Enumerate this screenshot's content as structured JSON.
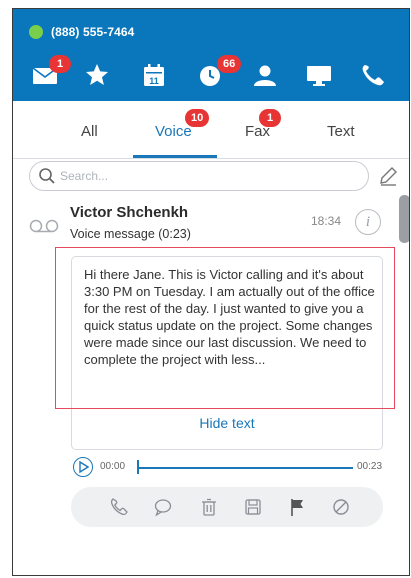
{
  "status": {
    "phone_number": "(888) 555-7464",
    "online_color": "#79cf4b"
  },
  "topbar": {
    "bg_color": "#0a77bd",
    "icons": [
      {
        "name": "mail-icon",
        "badge": "1"
      },
      {
        "name": "star-icon",
        "badge": ""
      },
      {
        "name": "calendar-icon",
        "badge": ""
      },
      {
        "name": "history-icon",
        "badge": "66"
      },
      {
        "name": "contacts-icon",
        "badge": ""
      },
      {
        "name": "desktop-icon",
        "badge": ""
      },
      {
        "name": "phone-icon",
        "badge": ""
      }
    ]
  },
  "tabs": [
    {
      "label": "All",
      "badge": ""
    },
    {
      "label": "Voice",
      "badge": "10",
      "active": true
    },
    {
      "label": "Fax",
      "badge": "1"
    },
    {
      "label": "Text",
      "badge": ""
    }
  ],
  "search": {
    "placeholder": "Search..."
  },
  "message": {
    "caller": "Victor Shchenkh",
    "subtitle": "Voice message (0:23)",
    "time": "18:34",
    "info_label": "i",
    "transcript": "Hi there Jane. This is Victor calling and it's about 3:30 PM on Tuesday. I am actually out of the office for the rest of the day. I just wanted to give you a quick status update on the project. Some changes were made since our last discussion. We need to complete the project with less...",
    "hide_label": "Hide text"
  },
  "player": {
    "current": "00:00",
    "duration": "00:23",
    "progress": 0
  },
  "actions": [
    {
      "name": "call-back-icon"
    },
    {
      "name": "message-icon"
    },
    {
      "name": "trash-icon"
    },
    {
      "name": "save-icon"
    },
    {
      "name": "flag-icon"
    },
    {
      "name": "block-icon"
    }
  ],
  "accent_color": "#1a77b8",
  "badge_color": "#e73434"
}
